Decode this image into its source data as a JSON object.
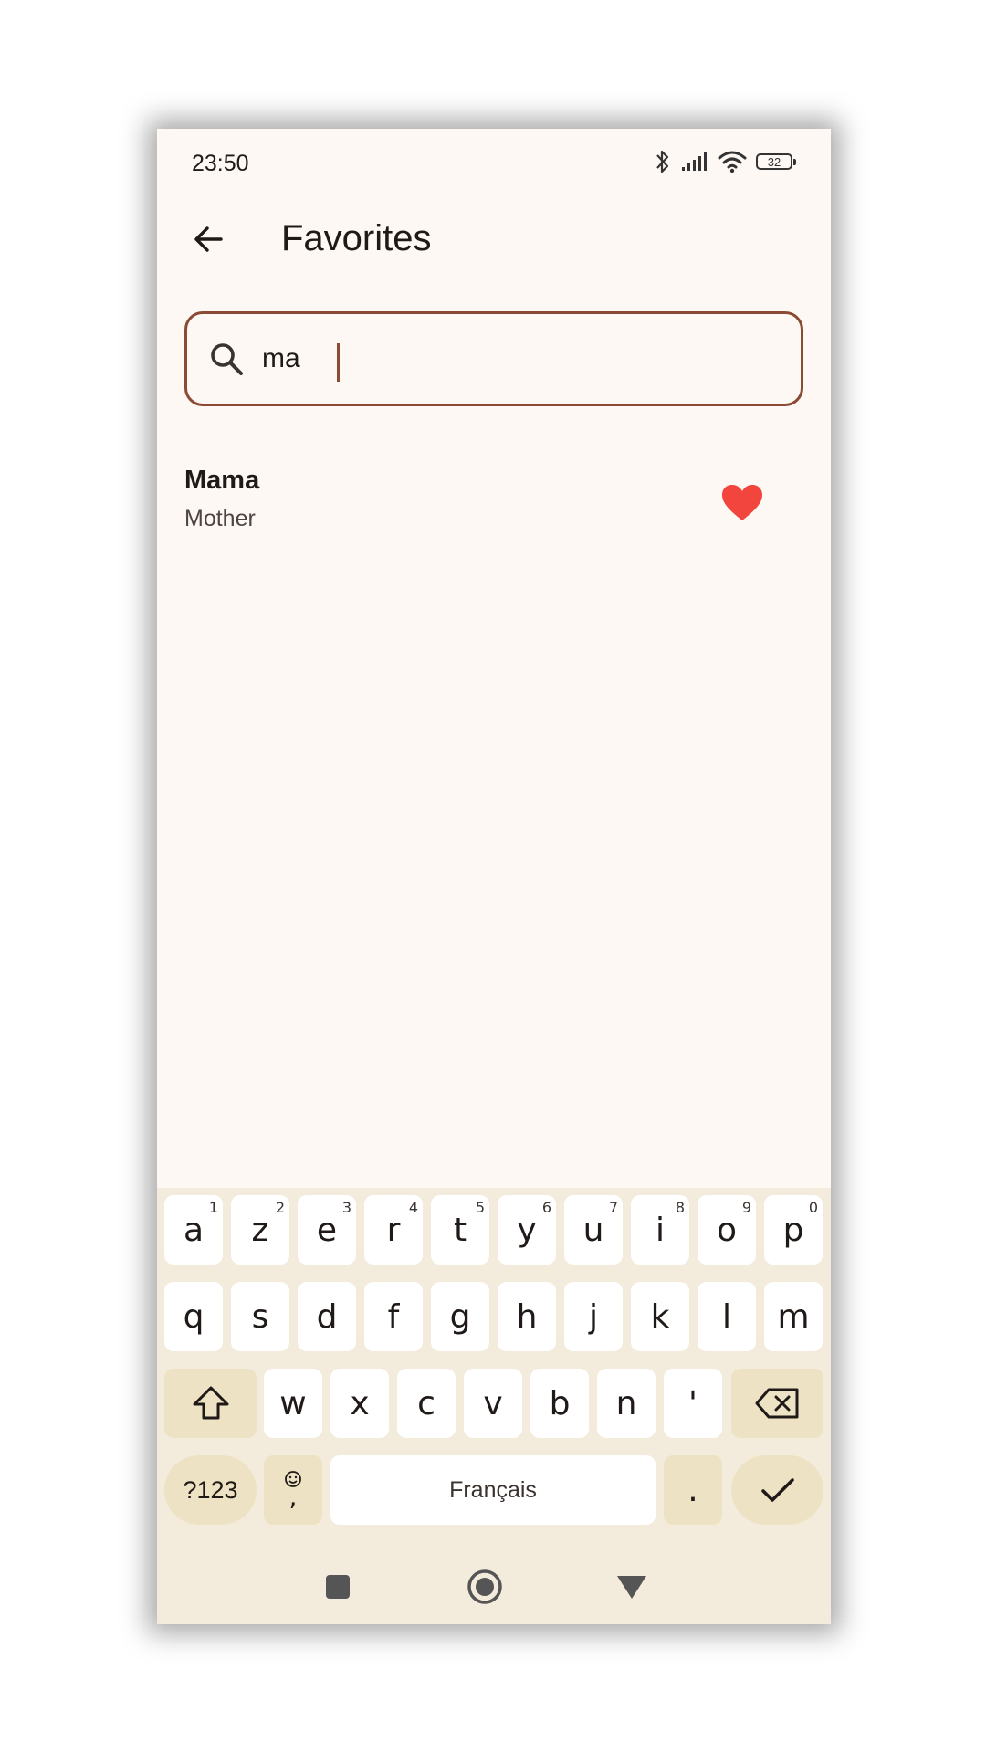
{
  "status_bar": {
    "time": "23:50",
    "battery": "32"
  },
  "app_bar": {
    "title": "Favorites"
  },
  "search": {
    "value": "ma"
  },
  "results": [
    {
      "name": "Mama",
      "subtitle": "Mother",
      "favorite": true
    }
  ],
  "keyboard": {
    "row1": [
      {
        "key": "a",
        "hint": "1"
      },
      {
        "key": "z",
        "hint": "2"
      },
      {
        "key": "e",
        "hint": "3"
      },
      {
        "key": "r",
        "hint": "4"
      },
      {
        "key": "t",
        "hint": "5"
      },
      {
        "key": "y",
        "hint": "6"
      },
      {
        "key": "u",
        "hint": "7"
      },
      {
        "key": "i",
        "hint": "8"
      },
      {
        "key": "o",
        "hint": "9"
      },
      {
        "key": "p",
        "hint": "0"
      }
    ],
    "row2": [
      "q",
      "s",
      "d",
      "f",
      "g",
      "h",
      "j",
      "k",
      "l",
      "m"
    ],
    "row3": [
      "w",
      "x",
      "c",
      "v",
      "b",
      "n",
      "'"
    ],
    "symbols_label": "?123",
    "comma_label": ",",
    "space_label": "Français",
    "period_label": "."
  },
  "colors": {
    "accent": "#8a4a33",
    "heart": "#f2453d",
    "keyboard_bg": "#f3ebdb",
    "modifier_key": "#ede3c4"
  }
}
